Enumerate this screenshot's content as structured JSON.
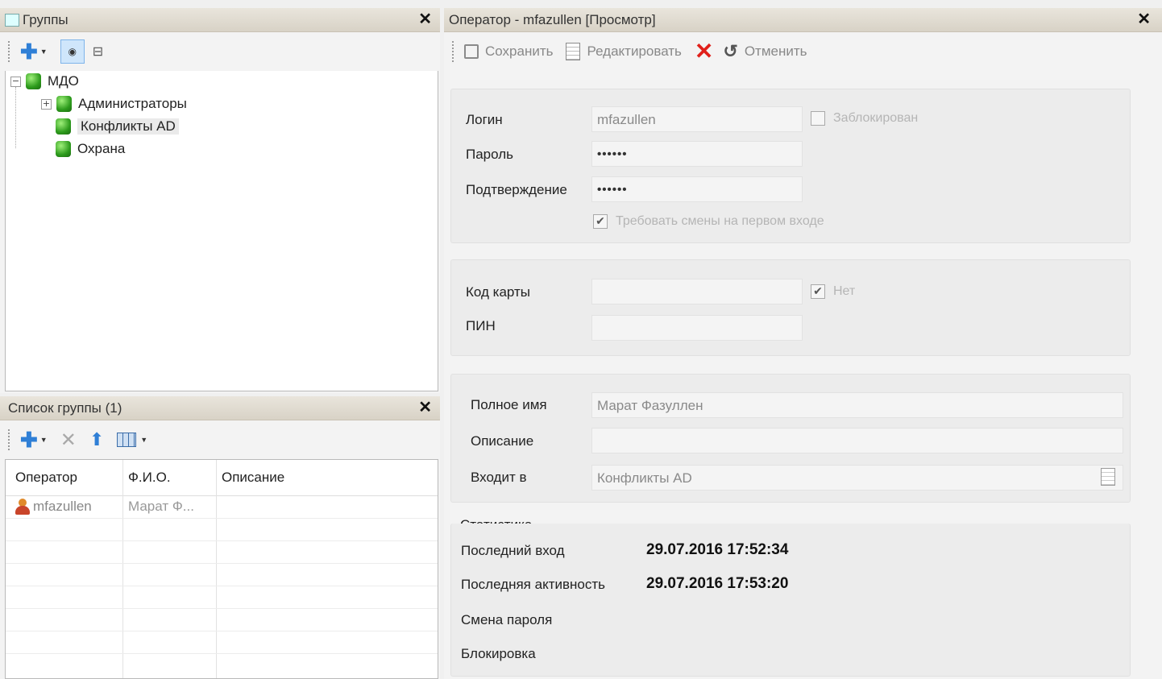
{
  "groups_panel": {
    "title": "Группы",
    "tree": [
      {
        "label": "МДО",
        "expander": "⊟"
      },
      {
        "label": "Администраторы",
        "expander": "⊞"
      },
      {
        "label": "Конфликты AD"
      },
      {
        "label": "Охрана"
      }
    ]
  },
  "group_list_panel": {
    "title": "Список группы (1)",
    "columns": [
      "Оператор",
      "Ф.И.О.",
      "Описание"
    ],
    "rows": [
      {
        "operator": "mfazullen",
        "fio": "Марат Ф...",
        "desc": ""
      }
    ]
  },
  "operator_panel": {
    "title": "Оператор - mfazullen [Просмотр]",
    "toolbar": {
      "save": "Сохранить",
      "edit": "Редактировать",
      "cancel": "Отменить"
    },
    "login_section": {
      "login_label": "Логин",
      "login_value": "mfazullen",
      "blocked_label": "Заблокирован",
      "password_label": "Пароль",
      "password_value": "••••••",
      "confirm_label": "Подтверждение",
      "confirm_value": "••••••",
      "require_change_label": "Требовать смены на первом входе"
    },
    "card_section": {
      "card_code_label": "Код карты",
      "card_code_value": "",
      "none_label": "Нет",
      "pin_label": "ПИН",
      "pin_value": ""
    },
    "info_section": {
      "fullname_label": "Полное имя",
      "fullname_value": "Марат Фазуллен",
      "description_label": "Описание",
      "description_value": "",
      "member_of_label": "Входит в",
      "member_of_value": "Конфликты AD"
    },
    "stats": {
      "title": "Статистика",
      "last_login_label": "Последний вход",
      "last_login_value": "29.07.2016 17:52:34",
      "last_activity_label": "Последняя активность",
      "last_activity_value": "29.07.2016 17:53:20",
      "pw_change_label": "Смена пароля",
      "blocking_label": "Блокировка"
    }
  },
  "colors": {
    "delete_red": "#e0201a",
    "add_blue": "#2f7fd6",
    "user_orange": "#e08a2a"
  }
}
